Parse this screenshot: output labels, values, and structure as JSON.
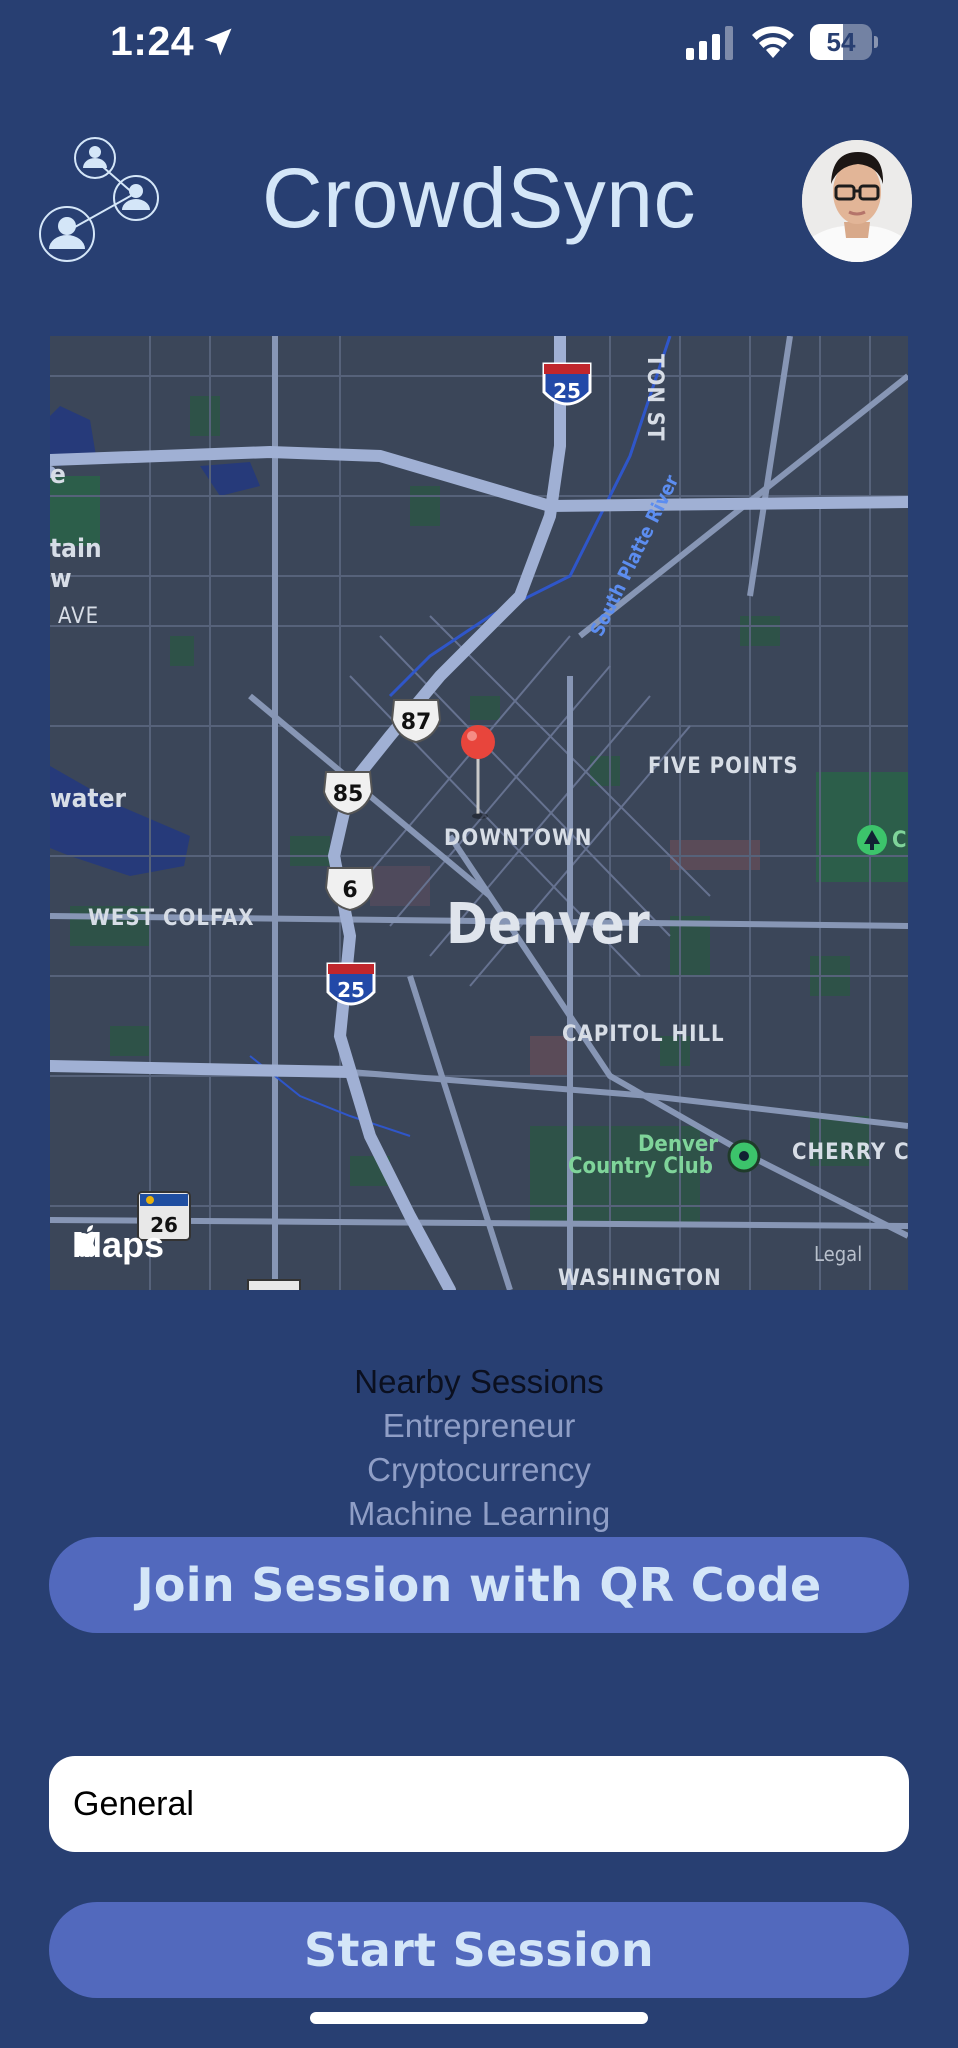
{
  "status_bar": {
    "time": "1:24",
    "battery_level": "54",
    "battery_fraction": 0.54,
    "signal_bars": 3,
    "icons": [
      "location-arrow-icon",
      "cellular-signal-icon",
      "wifi-icon",
      "battery-icon"
    ]
  },
  "header": {
    "app_title": "CrowdSync",
    "left_icon": "network-people-icon",
    "right_icon": "profile-avatar"
  },
  "map": {
    "city_label": "Denver",
    "neighborhoods": [
      "FIVE POINTS",
      "DOWNTOWN",
      "WEST COLFAX",
      "CAPITOL HILL",
      "WASHINGTON",
      "CHERRY CR",
      "AVE",
      "TON ST"
    ],
    "partial_labels": [
      "tain",
      "w",
      "e",
      "water",
      "C"
    ],
    "river": "South Platte River",
    "park": "Denver Country Club",
    "park_line1": "Denver",
    "park_line2": "Country Club",
    "highway_shields": [
      "25",
      "87",
      "85",
      "6",
      "25",
      "26"
    ],
    "attribution": "Maps",
    "legal": "Legal",
    "pin_icon": "map-pin-icon"
  },
  "picker": {
    "items": [
      "Nearby Sessions",
      "Entrepreneur",
      "Cryptocurrency",
      "Machine Learning"
    ],
    "selected_index": 0
  },
  "buttons": {
    "join_qr": "Join Session with QR Code",
    "start_session": "Start Session"
  },
  "session_input": {
    "value": "General"
  },
  "colors": {
    "background": "#283f72",
    "button": "#5269bd",
    "button_text": "#d4e6f8",
    "title": "#d4e6f8",
    "map_base": "#3b4659",
    "pin": "#e8453c"
  }
}
